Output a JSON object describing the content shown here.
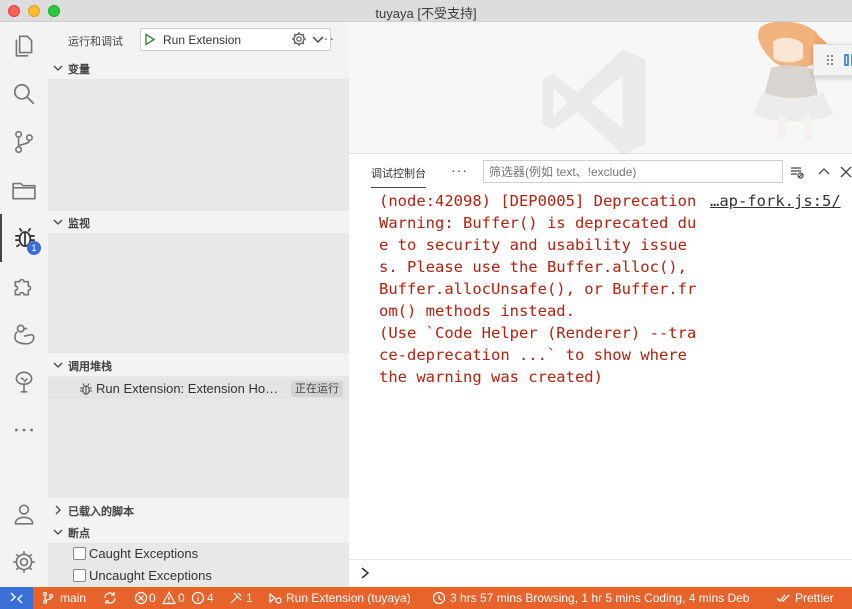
{
  "window": {
    "title": "tuyaya [不受支持]"
  },
  "sidebar": {
    "title": "运行和调试",
    "launch_config": "Run Extension",
    "sections": {
      "variables": "变量",
      "watch": "监视",
      "callstack": "调用堆栈",
      "loaded_scripts": "已载入的脚本",
      "breakpoints": "断点"
    },
    "callstack_item": {
      "label": "Run Extension: Extension Ho…",
      "status": "正在运行"
    },
    "breakpoints": [
      {
        "label": "Caught Exceptions",
        "checked": false
      },
      {
        "label": "Uncaught Exceptions",
        "checked": false
      }
    ]
  },
  "activity": {
    "debug_badge": "1"
  },
  "panel": {
    "tab": "调试控制台",
    "filter_placeholder": "筛选器(例如 text、!exclude)",
    "console_message": "(node:42098) [DEP0005] DeprecationWarning: Buffer() is deprecated due to security and usability issues. Please use the Buffer.alloc(), Buffer.allocUnsafe(), or Buffer.from() methods instead.\n(Use `Code Helper (Renderer) --trace-deprecation ...` to show where the warning was created)",
    "source_link": "…ap-fork.js:5/"
  },
  "statusbar": {
    "branch": "main",
    "errors": "0",
    "warnings": "0",
    "infos": "4",
    "debug_sessions": "1",
    "debug_target": "Run Extension (tuyaya)",
    "time_tracking": "3 hrs 57 mins Browsing, 1 hr 5 mins Coding, 4 mins Deb",
    "prettier": "Prettier"
  },
  "colors": {
    "statusbar_bg": "#e8622c",
    "remote_bg": "#3a6fd8",
    "console_error": "#b5200d"
  }
}
